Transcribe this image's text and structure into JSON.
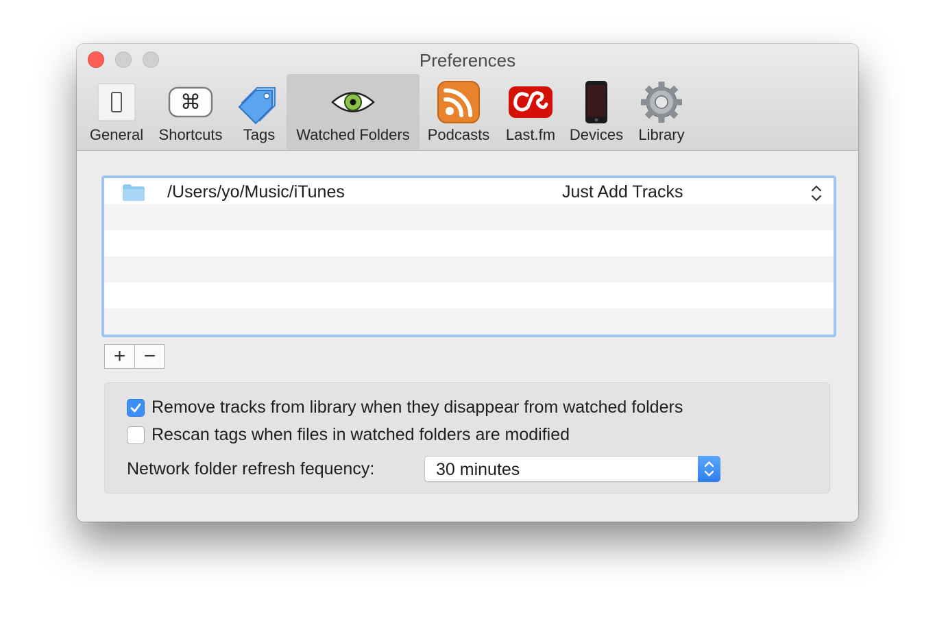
{
  "window": {
    "title": "Preferences"
  },
  "toolbar": {
    "items": [
      {
        "label": "General",
        "icon": "switch-icon"
      },
      {
        "label": "Shortcuts",
        "icon": "command-key-icon"
      },
      {
        "label": "Tags",
        "icon": "tags-icon"
      },
      {
        "label": "Watched Folders",
        "icon": "eye-icon",
        "selected": true
      },
      {
        "label": "Podcasts",
        "icon": "rss-icon"
      },
      {
        "label": "Last.fm",
        "icon": "lastfm-icon"
      },
      {
        "label": "Devices",
        "icon": "phone-icon"
      },
      {
        "label": "Library",
        "icon": "gear-icon"
      }
    ]
  },
  "watched_folders": {
    "rows": [
      {
        "path": "/Users/yo/Music/iTunes",
        "action": "Just Add Tracks"
      }
    ],
    "add_label": "+",
    "remove_label": "−"
  },
  "options": {
    "remove_tracks_label": "Remove tracks from library when they disappear from watched folders",
    "remove_tracks_checked": true,
    "rescan_tags_label": "Rescan tags when files in watched folders are modified",
    "rescan_tags_checked": false,
    "refresh_label": "Network folder refresh fequency:",
    "refresh_value": "30 minutes"
  },
  "colors": {
    "accent": "#3b8ff5",
    "focus_ring": "#9ec3ec",
    "close_button": "#fd5f57",
    "podcast_orange": "#e8822c",
    "lastfm_red": "#d51007"
  }
}
